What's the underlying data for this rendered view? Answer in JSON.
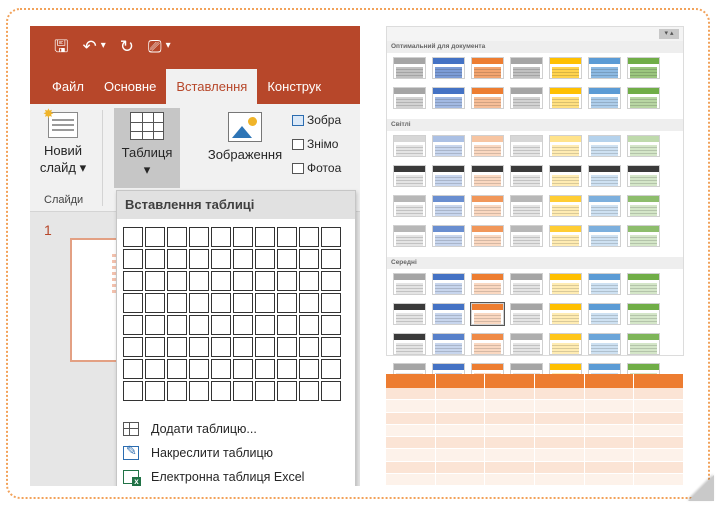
{
  "ppt": {
    "tabs": [
      {
        "label": "Файл",
        "active": false
      },
      {
        "label": "Основне",
        "active": false
      },
      {
        "label": "Вставлення",
        "active": true
      },
      {
        "label": "Конструк",
        "active": false
      }
    ],
    "ribbon": {
      "new_slide_line1": "Новий",
      "new_slide_line2": "слайд ▾",
      "table_label": "Таблиця",
      "table_caret": "▾",
      "images_label": "Зображення",
      "side_item_1": "Зобра",
      "side_item_2": "Знімо",
      "side_item_3": "Фотоа",
      "group_slides": "Слайди"
    },
    "slide_number": "1",
    "insert_table_menu": {
      "title": "Вставлення таблиці",
      "grid_cols": 10,
      "grid_rows": 8,
      "items": [
        {
          "label": "Додати таблицю...",
          "icon": "table-icon"
        },
        {
          "label": "Накреслити таблицю",
          "icon": "draw-table-icon"
        },
        {
          "label": "Електронна таблиця Excel",
          "icon": "excel-table-icon"
        }
      ]
    }
  },
  "gallery": {
    "section_labels": [
      "Оптимальний для документа",
      "Світлі",
      "Середні"
    ],
    "colors": [
      "#a5a5a5",
      "#4472c4",
      "#ed7d31",
      "#a5a5a5",
      "#ffc000",
      "#5b9bd5",
      "#70ad47"
    ],
    "dark_header": "#3a3a3a"
  },
  "sample_table": {
    "header_color": "#ed7d31",
    "band_a": "#fbe4d5",
    "band_b": "#fdf2ea",
    "columns": 6,
    "rows": 6
  }
}
